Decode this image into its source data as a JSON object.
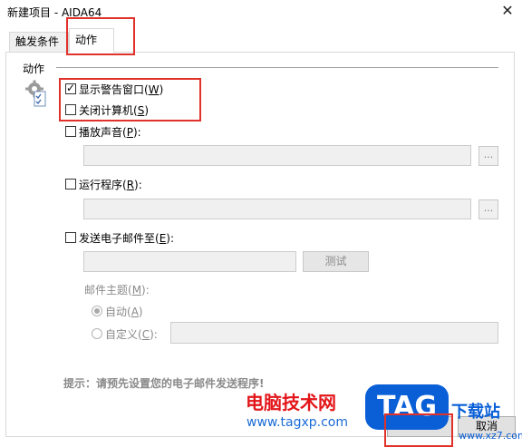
{
  "window": {
    "title": "新建项目 - AIDA64",
    "close_glyph": "✕"
  },
  "tabs": [
    {
      "label": "触发条件",
      "active": false
    },
    {
      "label": "动作",
      "active": true
    }
  ],
  "group": {
    "label": "动作"
  },
  "actions": {
    "show_warning": {
      "label_main": "显示警告窗口(",
      "key": "W",
      "label_end": ")",
      "checked": true
    },
    "shutdown": {
      "label_main": "关闭计算机(",
      "key": "S",
      "label_end": ")",
      "checked": false
    },
    "play_sound": {
      "label_main": "播放声音(",
      "key": "P",
      "label_end": "):",
      "checked": false,
      "value": "",
      "browse": "..."
    },
    "run_program": {
      "label_main": "运行程序(",
      "key": "R",
      "label_end": "):",
      "checked": false,
      "value": "",
      "browse": "..."
    },
    "send_email": {
      "label_main": "发送电子邮件至(",
      "key": "E",
      "label_end": "):",
      "checked": false,
      "value": "",
      "test_button": "测试"
    }
  },
  "email": {
    "subject_label_main": "邮件主题(",
    "subject_key": "M",
    "subject_label_end": "):",
    "auto_label_main": "自动(",
    "auto_key": "A",
    "auto_label_end": ")",
    "custom_label_main": "自定义(",
    "custom_key": "C",
    "custom_label_end": "):",
    "custom_value": ""
  },
  "hint": "提示：请预先设置您的电子邮件发送程序!",
  "buttons": {
    "ok": "OK",
    "cancel": "取消"
  },
  "watermark": {
    "site_name": "电脑技术网",
    "site_url": "www.tagxp.com",
    "tag": "TAG",
    "download": "下载站",
    "xz_url": "www.xz7.com"
  },
  "colors": {
    "highlight": "#e0322b",
    "brand_blue": "#0a5fd7",
    "brand_red": "#e3161a"
  }
}
